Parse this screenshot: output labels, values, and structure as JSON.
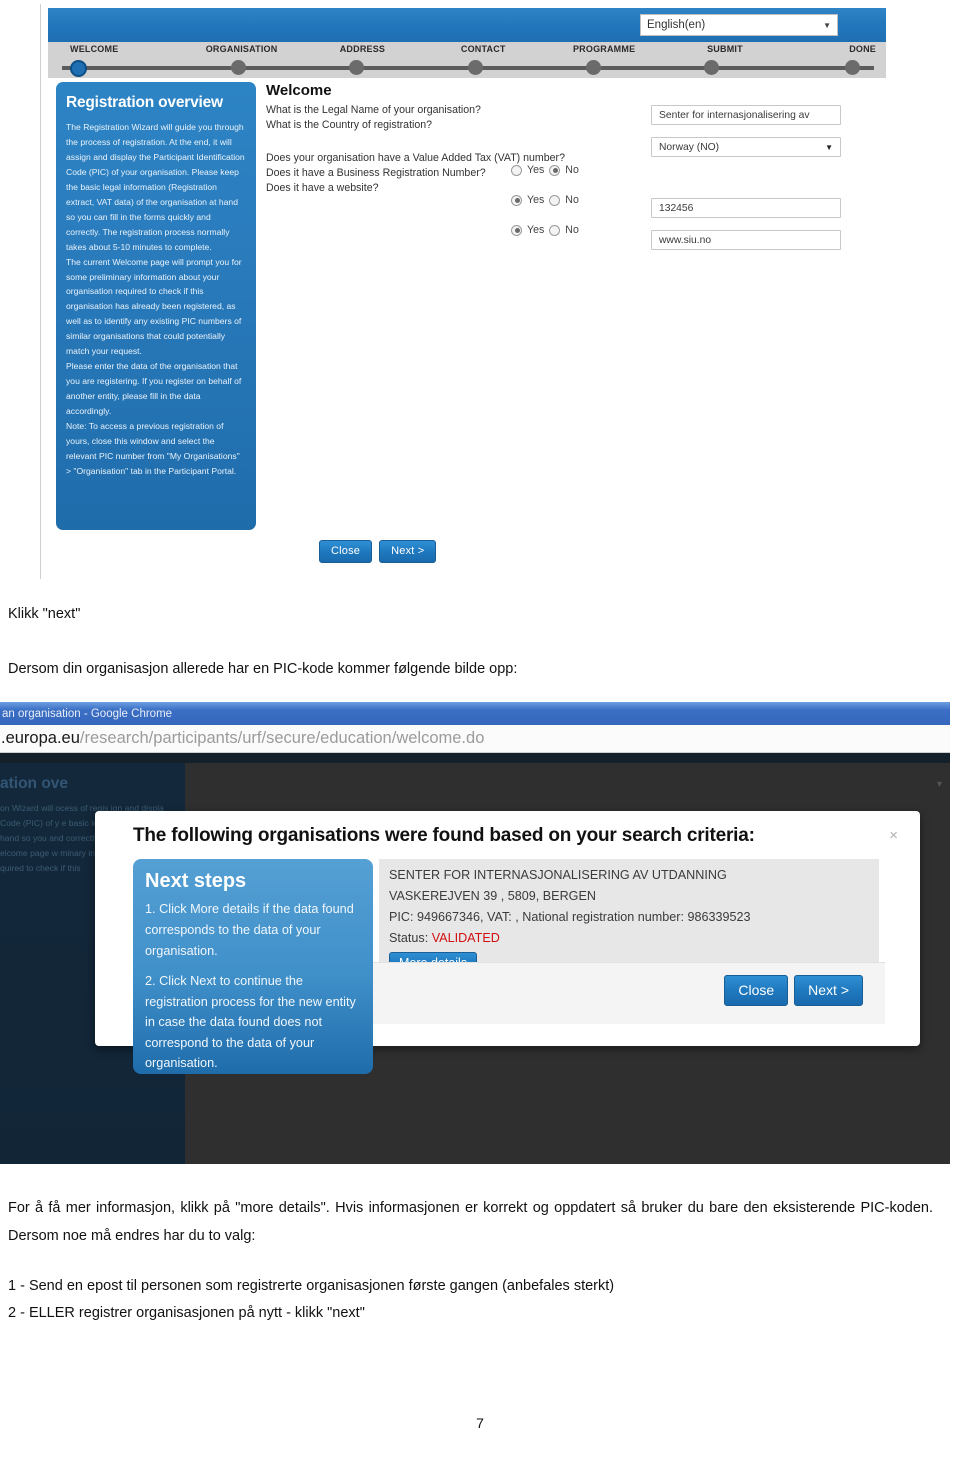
{
  "document": {
    "page_number": "7",
    "paragraphs": {
      "klikk_next": "Klikk \"next\"",
      "dersom_pic": "Dersom din organisasjon allerede har en PIC-kode kommer følgende bilde opp:",
      "more_details_info": "For å få mer informasjon, klikk på \"more details\". Hvis informasjonen er korrekt og oppdatert så bruker du bare den eksisterende PIC-koden. Dersom noe må endres har du to valg:",
      "option_1": "1 - Send en epost til personen som registrerte organisasjonen første gangen (anbefales sterkt)",
      "option_2": "2 - ELLER registrer organisasjonen på nytt - klikk \"next\""
    }
  },
  "screenshot_1": {
    "language_selector": {
      "value": "English(en)",
      "caret": "▼"
    },
    "steps": [
      {
        "label": "WELCOME",
        "active": true
      },
      {
        "label": "ORGANISATION",
        "active": false
      },
      {
        "label": "ADDRESS",
        "active": false
      },
      {
        "label": "CONTACT",
        "active": false
      },
      {
        "label": "PROGRAMME",
        "active": false
      },
      {
        "label": "SUBMIT",
        "active": false
      },
      {
        "label": "DONE",
        "active": false
      }
    ],
    "registration_overview": {
      "title": "Registration overview",
      "para_1": "The Registration Wizard will guide you through the process of registration. At the end, it will assign and display the Participant Identification Code (PIC) of your organisation. Please keep the basic legal information (Registration extract, VAT data) of the organisation at hand so you can fill in the forms quickly and correctly. The registration process normally takes about 5-10 minutes to complete.",
      "para_2": "The current Welcome page will prompt you for some preliminary information about your organisation required to check if this organisation has already been registered, as well as to identify any existing PIC numbers of similar organisations that could potentially match your request.",
      "para_3": "Please enter the data of the organisation that you are registering. If you register on behalf of another entity, please fill in the data accordingly.",
      "para_4": "Note: To access a previous registration of yours, close this window and select the relevant PIC number from \"My Organisations\" > \"Organisation\" tab in the Participant Portal."
    },
    "welcome_form": {
      "title": "Welcome",
      "q_legal_name": "What is the Legal Name of your organisation?",
      "q_country": "What is the Country of registration?",
      "q_vat": "Does your organisation have a Value Added Tax (VAT) number?",
      "q_business_reg": "Does it have a Business Registration Number?",
      "q_website": "Does it have a website?",
      "yes_label": "Yes",
      "no_label": "No",
      "answers": {
        "vat": "No",
        "business_reg": "Yes",
        "website": "Yes"
      },
      "legal_name_value": "Senter for internasjonalisering av",
      "country_value": "Norway (NO)",
      "country_caret": "▼",
      "business_reg_value": "132456",
      "website_value": "www.siu.no"
    },
    "buttons": {
      "close": "Close",
      "next": "Next >"
    }
  },
  "screenshot_2": {
    "browser": {
      "title": "an organisation - Google Chrome",
      "url_dark": ".europa.eu",
      "url_grey": "/research/participants/urf/secure/education/welcome.do"
    },
    "modal": {
      "heading": "The following organisations were found based on your search criteria:",
      "close_icon": "×",
      "next_steps": {
        "title": "Next steps",
        "step_1": "1. Click More details if the data found corresponds to the data of your organisation.",
        "step_2": "2. Click Next to continue the registration process for the new entity in case the data found does not correspond to the data of your organisation."
      },
      "organisation": {
        "name": "SENTER FOR INTERNASJONALISERING AV UTDANNING",
        "address": "VASKEREJVEN 39 , 5809, BERGEN",
        "identifiers": "PIC: 949667346, VAT: , National registration number: 986339523",
        "status_label": "Status:",
        "status_value": "VALIDATED",
        "more_details_button": "More details"
      },
      "buttons": {
        "close": "Close",
        "next": "Next >"
      }
    },
    "background_overlay": {
      "title_fragment": "ation ove",
      "text_fragment": "on Wizard will  ocess of regis  ign and displa  Code (PIC) of y  e basic legal i  xtract, VAT d  t hand so you  and correctly.  ally takes abou",
      "text_fragment_2": "elcome page w  minary information about your  quired to check if this"
    }
  }
}
